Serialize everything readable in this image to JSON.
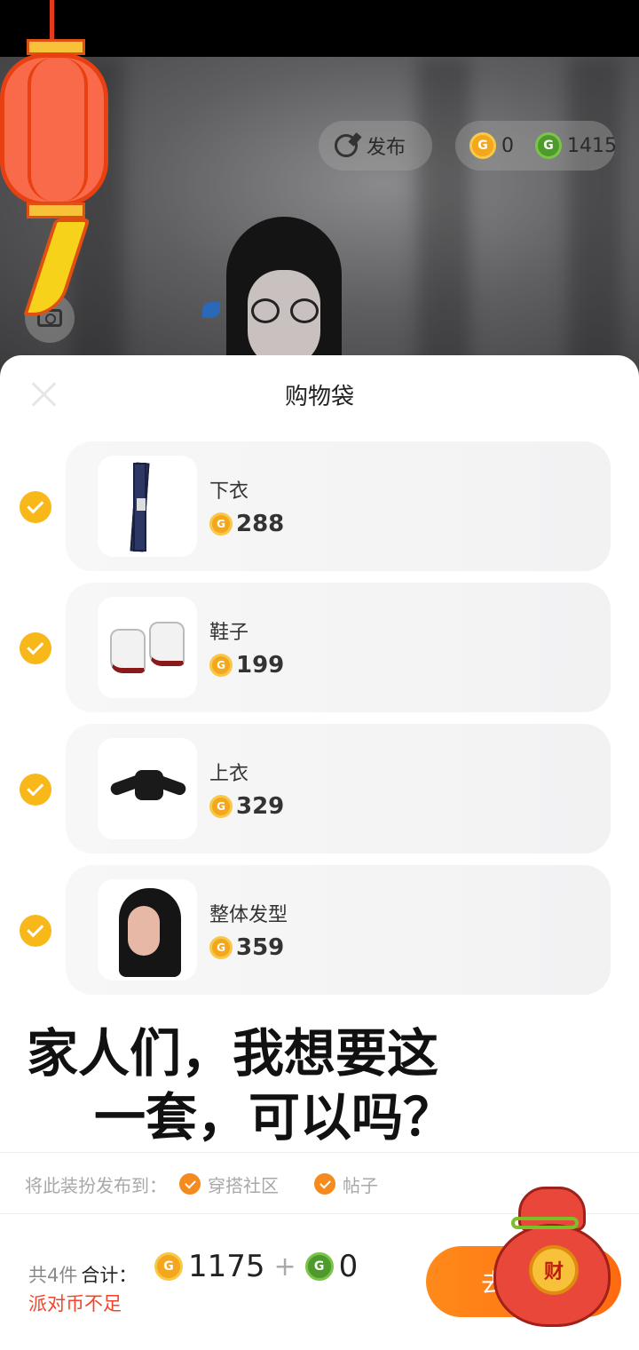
{
  "header": {
    "publish_label": "发布",
    "balance_gold": "0",
    "balance_green": "1415"
  },
  "sheet": {
    "title": "购物袋"
  },
  "items": [
    {
      "name": "下衣",
      "price": "288",
      "checked": true
    },
    {
      "name": "鞋子",
      "price": "199",
      "checked": true
    },
    {
      "name": "上衣",
      "price": "329",
      "checked": true
    },
    {
      "name": "整体发型",
      "price": "359",
      "checked": true
    }
  ],
  "caption": {
    "line1": "家人们，我想要这",
    "line2": "一套，可以吗？"
  },
  "share": {
    "prefix": "将此装扮发布到：",
    "options": [
      {
        "label": "穿搭社区",
        "checked": true
      },
      {
        "label": "帖子",
        "checked": true
      }
    ]
  },
  "footer": {
    "count": "共4件",
    "total_label": "合计：",
    "gold_total": "1175",
    "plus": "+",
    "green_total": "0",
    "warning": "派对币不足",
    "go_label": "去"
  },
  "decor": {
    "moneybag_char": "财"
  },
  "colors": {
    "accent_orange": "#ff7a14",
    "check_yellow": "#f8b81a",
    "warning_red": "#f0452a",
    "coin_gold": "#f4a61d",
    "coin_green": "#4e9a2c"
  }
}
